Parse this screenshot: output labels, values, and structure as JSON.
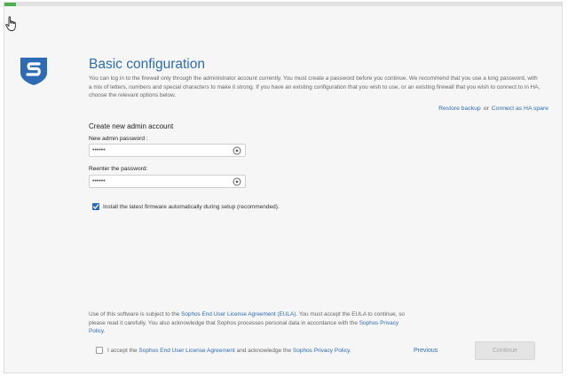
{
  "progress": {
    "fraction": 0.02,
    "color": "#4caf50"
  },
  "cursor_icon": "hand-pointer-icon",
  "logo_icon": "sophos-shield-logo",
  "colors": {
    "accent": "#2d6cb5",
    "page_bg": "#f6f6f6"
  },
  "header": {
    "title": "Basic configuration",
    "intro": "You can log in to the firewall only through the administrator account currently. You must create a password before you continue. We recommend that you use a long password, with a mix of letters, numbers and special characters to make it strong. If you have an existing configuration that you wish to use, or an existing firewall that you wish to connect to in HA, choose the relevant options below."
  },
  "links": {
    "restore_backup": "Restore backup",
    "or": "or",
    "connect_ha": "Connect as HA spare"
  },
  "admin": {
    "section_title": "Create new admin account",
    "password_label": "New admin password :",
    "password_value": "••••••",
    "reenter_label": "Reenter the password:",
    "reenter_value": "••••••",
    "reveal_icon": "eye-reveal-icon"
  },
  "firmware": {
    "checked": true,
    "label": "Install the latest firmware automatically during setup (recommended)."
  },
  "legal": {
    "part1": "Use of this software is subject to the ",
    "eula_link": "Sophos End User License Agreement (EULA)",
    "part2": ". You must accept the EULA to continue, so please read it carefully. You also acknowledge that Sophos processes personal data in accordance with the ",
    "privacy_link": "Sophos Privacy Policy",
    "part3": "."
  },
  "accept": {
    "checked": false,
    "part1": "I accept the ",
    "eula_link": "Sophos End User License Agreement",
    "part2": " and acknowledge the ",
    "privacy_link": "Sophos Privacy Policy",
    "part3": "."
  },
  "footer": {
    "previous": "Previous",
    "continue": "Continue"
  }
}
